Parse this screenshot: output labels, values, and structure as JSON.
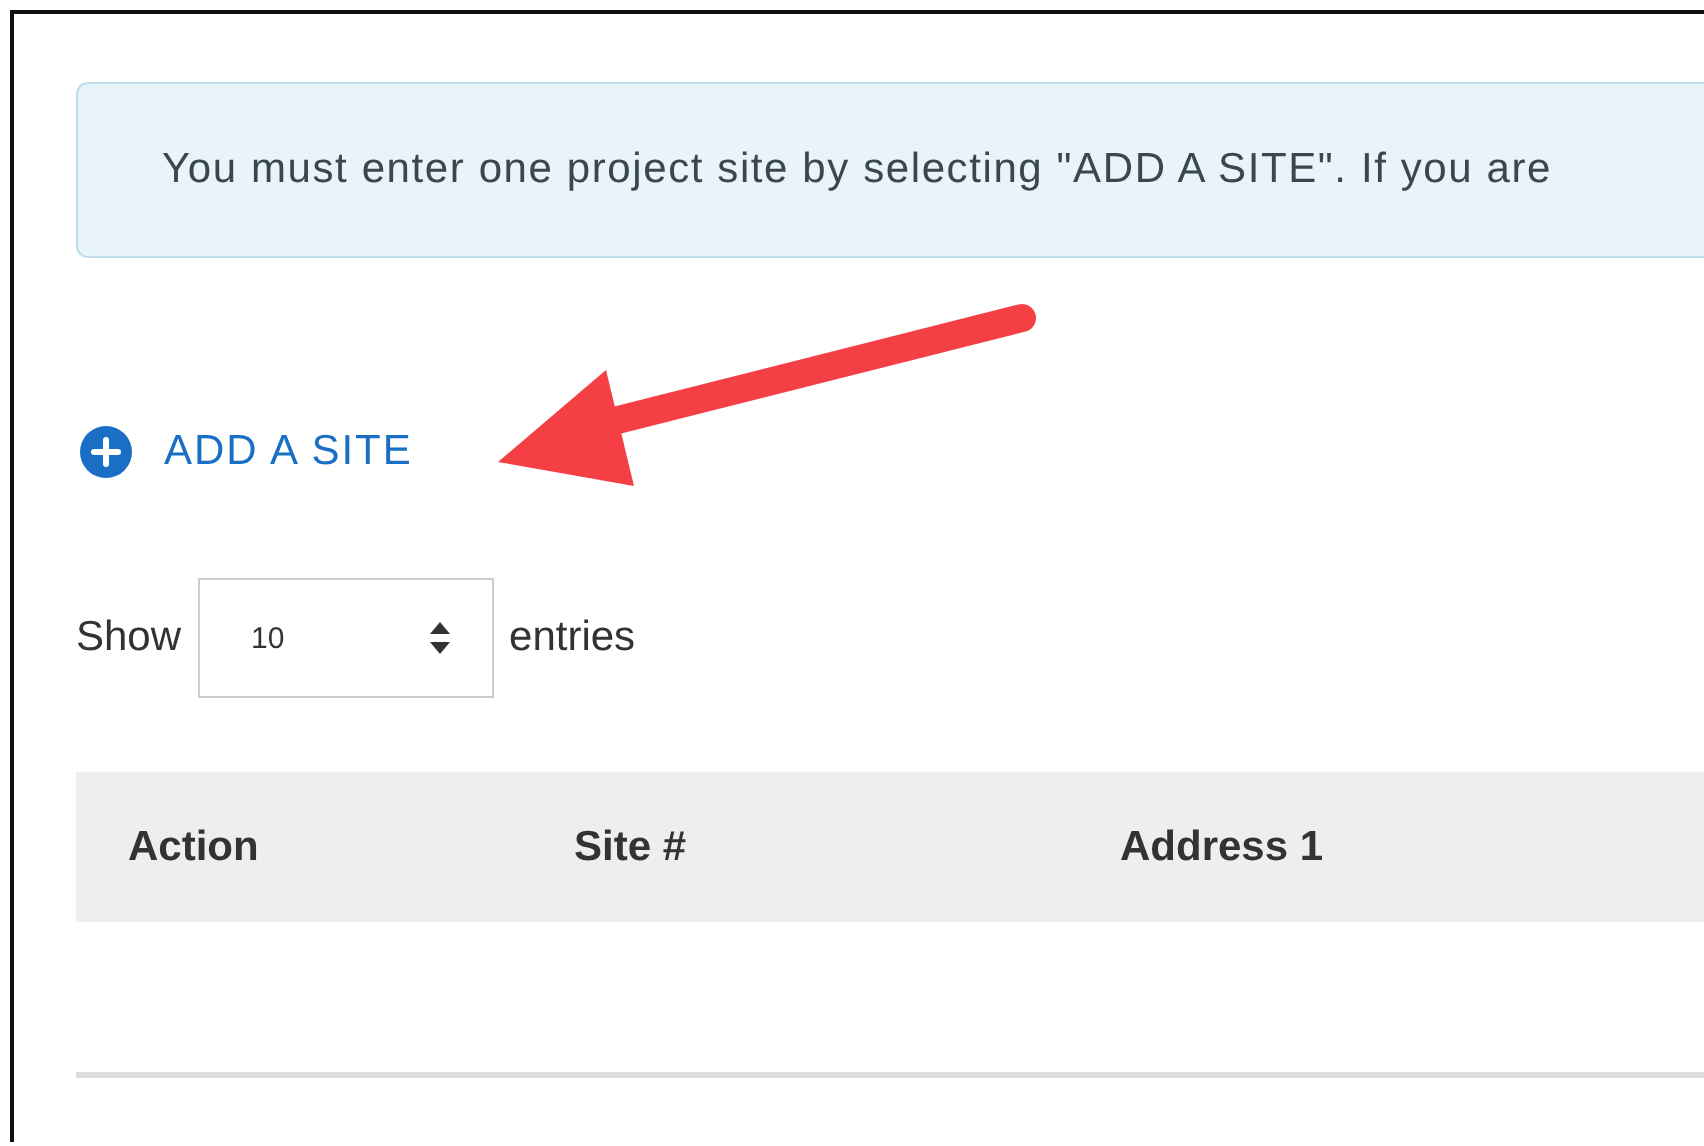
{
  "notice": {
    "text": "You must enter one project site by selecting \"ADD A SITE\". If you are"
  },
  "add_site_link": {
    "label": "ADD A SITE"
  },
  "page_length": {
    "prefix": "Show",
    "value": "10",
    "suffix": "entries"
  },
  "table": {
    "columns": [
      "Action",
      "Site #",
      "Address 1"
    ]
  }
}
